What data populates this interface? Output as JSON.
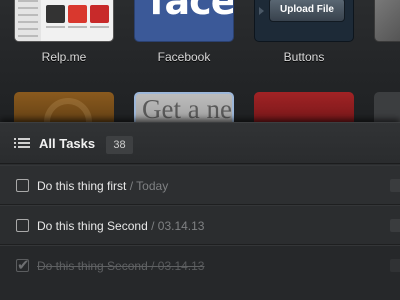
{
  "apps": [
    {
      "label": "Relp.me"
    },
    {
      "label": "Facebook",
      "tile_text": "face"
    },
    {
      "label": "Buttons",
      "tile_button": "Upload File"
    }
  ],
  "second_row_tile_text": "Get a ne",
  "tasks_panel": {
    "title": "All Tasks",
    "count": "38",
    "items": [
      {
        "text": "Do this thing first",
        "sep": " / ",
        "date": "Today",
        "done": false
      },
      {
        "text": "Do this thing Second",
        "sep": " / ",
        "date": "03.14.13",
        "done": false
      },
      {
        "text": "Do this thing Second",
        "sep": " / ",
        "date": "03.14.13",
        "done": true
      }
    ]
  },
  "colors": {
    "background": "#222426",
    "facebook_blue": "#3b5998",
    "red_tile": "#a22325"
  },
  "icons": [
    "list-icon",
    "checkbox-icon",
    "checkmark-icon"
  ]
}
